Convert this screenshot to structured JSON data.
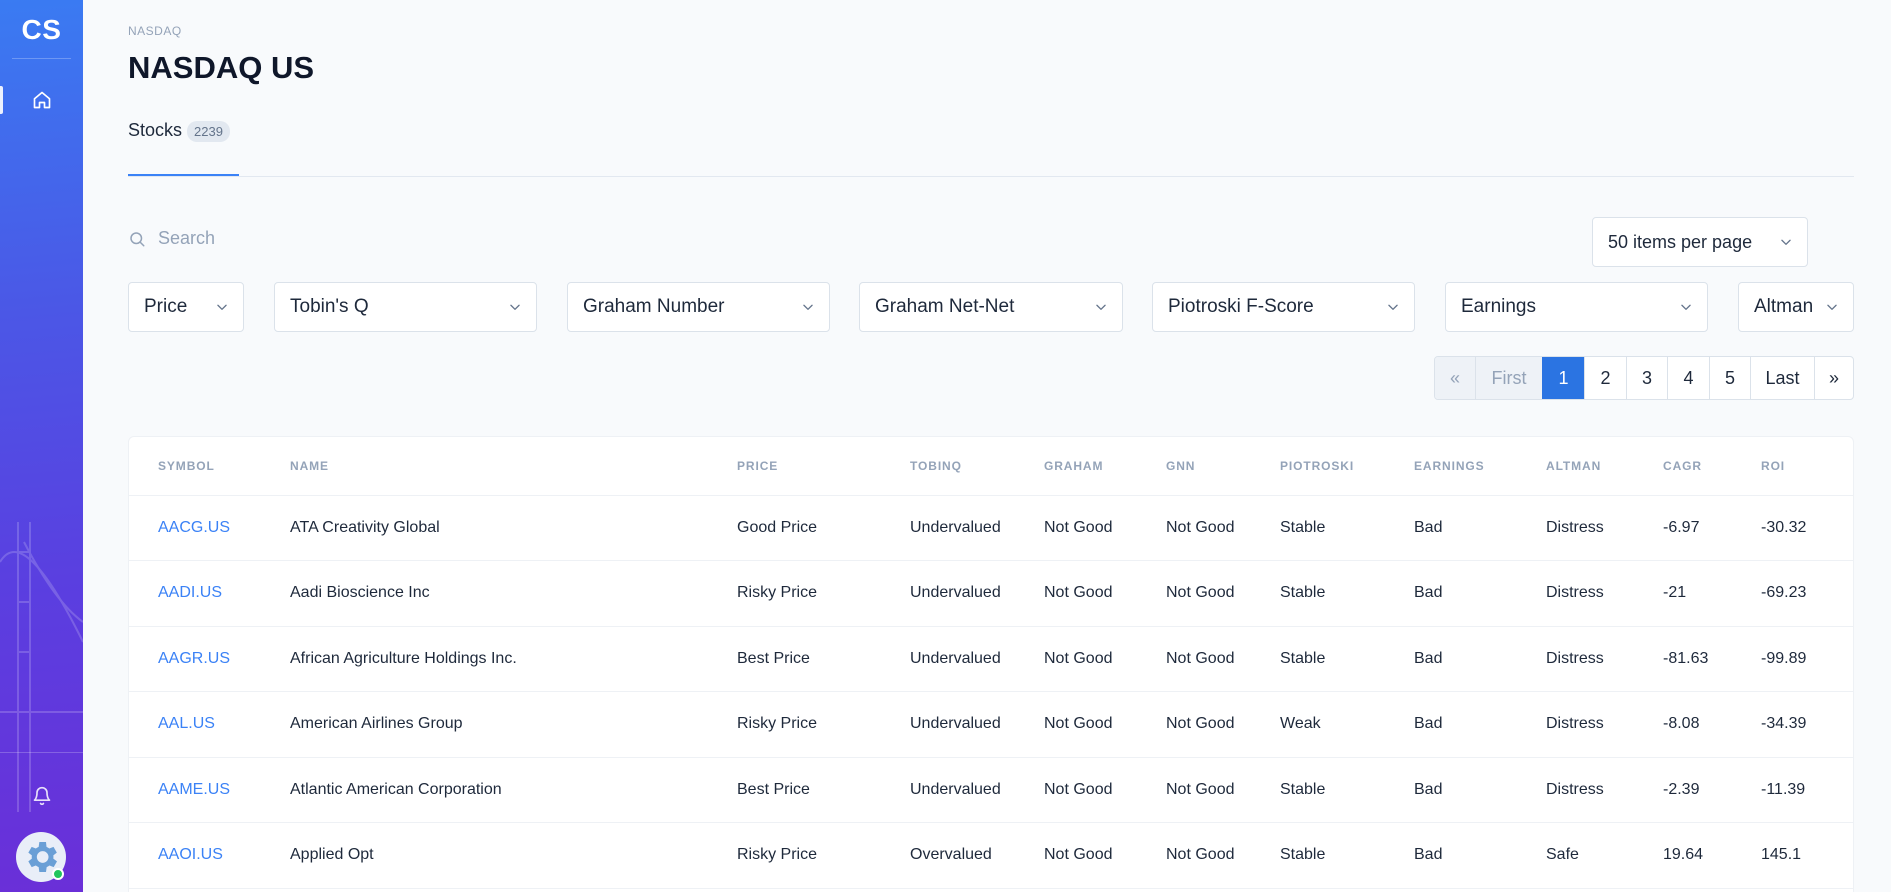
{
  "sidebar": {
    "logo": "CS",
    "items": [
      {
        "name": "home",
        "icon": "home-icon"
      }
    ],
    "bottom": {
      "notification_icon": "bell-icon",
      "avatar_icon": "gear-icon",
      "status": "online"
    }
  },
  "header": {
    "breadcrumb": "NASDAQ",
    "title": "NASDAQ US"
  },
  "tabs": [
    {
      "label": "Stocks",
      "count": "2239"
    }
  ],
  "search": {
    "placeholder": "Search",
    "value": ""
  },
  "per_page": {
    "selected": "50 items per page"
  },
  "filters": [
    {
      "label": "Price"
    },
    {
      "label": "Tobin's Q"
    },
    {
      "label": "Graham Number"
    },
    {
      "label": "Graham Net-Net"
    },
    {
      "label": "Piotroski F-Score"
    },
    {
      "label": "Earnings"
    },
    {
      "label": "Altman"
    }
  ],
  "pagination": {
    "prev": "«",
    "first": "First",
    "pages": [
      "1",
      "2",
      "3",
      "4",
      "5"
    ],
    "current": "1",
    "last": "Last",
    "next": "»"
  },
  "table": {
    "columns": [
      "SYMBOL",
      "NAME",
      "PRICE",
      "TOBINQ",
      "GRAHAM",
      "GNN",
      "PIOTROSKI",
      "EARNINGS",
      "ALTMAN",
      "CAGR",
      "ROI"
    ],
    "rows": [
      [
        "AACG.US",
        "ATA Creativity Global",
        "Good Price",
        "Undervalued",
        "Not Good",
        "Not Good",
        "Stable",
        "Bad",
        "Distress",
        "-6.97",
        "-30.32"
      ],
      [
        "AADI.US",
        "Aadi Bioscience Inc",
        "Risky Price",
        "Undervalued",
        "Not Good",
        "Not Good",
        "Stable",
        "Bad",
        "Distress",
        "-21",
        "-69.23"
      ],
      [
        "AAGR.US",
        "African Agriculture Holdings Inc.",
        "Best Price",
        "Undervalued",
        "Not Good",
        "Not Good",
        "Stable",
        "Bad",
        "Distress",
        "-81.63",
        "-99.89"
      ],
      [
        "AAL.US",
        "American Airlines Group",
        "Risky Price",
        "Undervalued",
        "Not Good",
        "Not Good",
        "Weak",
        "Bad",
        "Distress",
        "-8.08",
        "-34.39"
      ],
      [
        "AAME.US",
        "Atlantic American Corporation",
        "Best Price",
        "Undervalued",
        "Not Good",
        "Not Good",
        "Stable",
        "Bad",
        "Distress",
        "-2.39",
        "-11.39"
      ],
      [
        "AAOI.US",
        "Applied Opt",
        "Risky Price",
        "Overvalued",
        "Not Good",
        "Not Good",
        "Stable",
        "Bad",
        "Safe",
        "19.64",
        "145.1"
      ]
    ]
  },
  "colors": {
    "accent": "#2b74e2",
    "link": "#3b82f6",
    "sidebar_top": "#3a7bf2",
    "sidebar_bottom": "#6a2fd8"
  }
}
